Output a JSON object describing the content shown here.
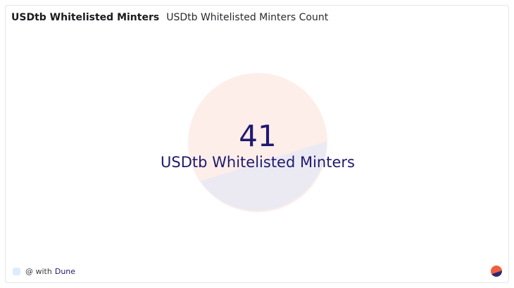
{
  "header": {
    "title": "USDtb Whitelisted Minters",
    "subtitle": "USDtb Whitelisted Minters Count"
  },
  "counter": {
    "value": "41",
    "label": "USDtb Whitelisted Minters"
  },
  "footer": {
    "prefix": "@ with",
    "brand": "Dune"
  },
  "icons": {
    "background_mark": "dune-logo-watermark-icon",
    "corner_logo": "dune-logo-icon",
    "author_avatar": "author-avatar-icon"
  },
  "colors": {
    "counter_text": "#1f1a6e",
    "dune_orange": "#f06040",
    "dune_navy": "#2c2a72",
    "watermark_orange": "#fdeeea",
    "watermark_navy": "#ebeaf2"
  }
}
